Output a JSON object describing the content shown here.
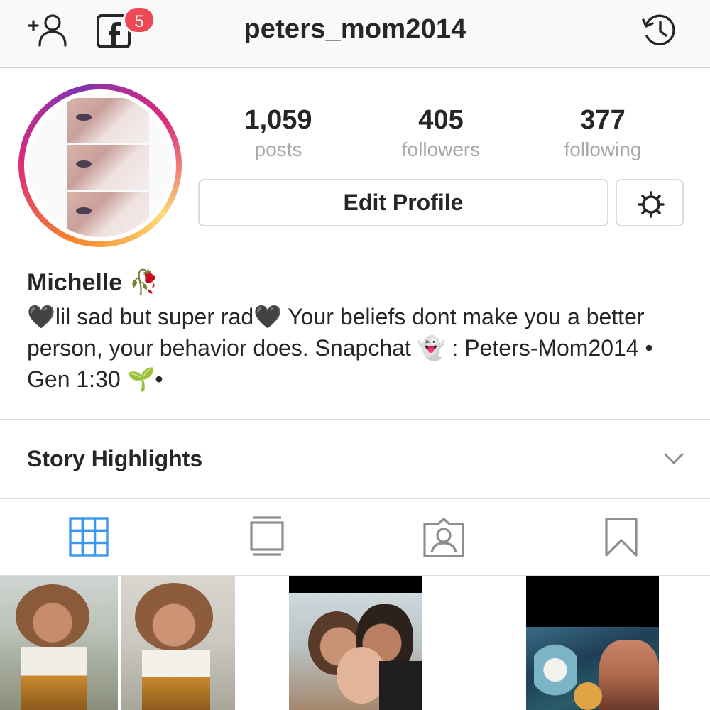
{
  "header": {
    "username": "peters_mom2014",
    "notification_count": "5",
    "icons": {
      "add_user": "add-user-icon",
      "facebook": "facebook-icon",
      "history": "history-icon"
    }
  },
  "profile": {
    "stats": [
      {
        "value": "1,059",
        "label": "posts"
      },
      {
        "value": "405",
        "label": "followers"
      },
      {
        "value": "377",
        "label": "following"
      }
    ],
    "edit_label": "Edit Profile",
    "display_name": "Michelle 🥀",
    "bio": "🖤lil sad but super rad🖤 Your beliefs dont make you a better person, your behavior does. Snapchat 👻 : Peters-Mom2014 • Gen 1:30 🌱•"
  },
  "highlights": {
    "label": "Story Highlights"
  },
  "tabs": [
    {
      "name": "grid",
      "icon": "grid-icon",
      "active": true
    },
    {
      "name": "feed",
      "icon": "feed-icon",
      "active": false
    },
    {
      "name": "tagged",
      "icon": "tagged-icon",
      "active": false
    },
    {
      "name": "saved",
      "icon": "bookmark-icon",
      "active": false
    }
  ],
  "colors": {
    "accent": "#3897f0",
    "badge": "#ed4956",
    "text": "#262626",
    "muted": "#a8a8a8",
    "border": "#dbdbdb"
  }
}
